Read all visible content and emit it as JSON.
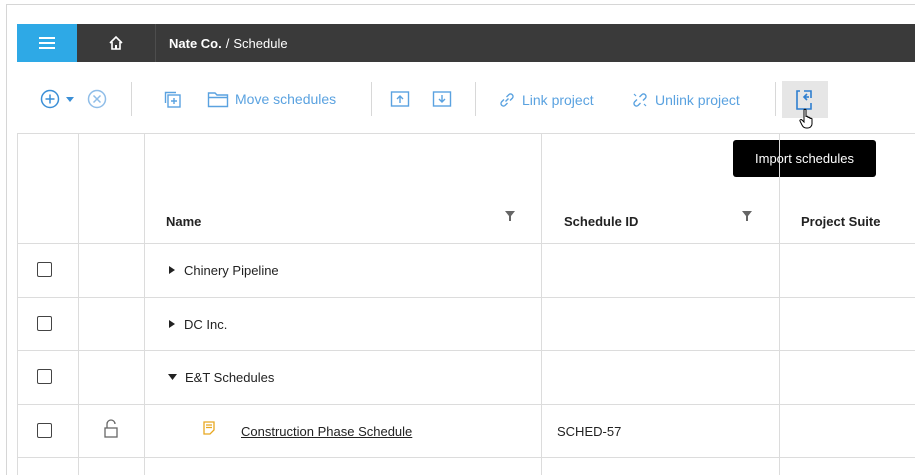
{
  "topbar": {
    "company": "Nate Co.",
    "separator": "/",
    "page": "Schedule"
  },
  "toolbar": {
    "move_schedules": "Move schedules",
    "link_project": "Link project",
    "unlink_project": "Unlink project",
    "tooltip": "Import schedules"
  },
  "table": {
    "headers": {
      "name": "Name",
      "schedule_id": "Schedule ID",
      "project_suite": "Project Suite"
    },
    "rows": [
      {
        "name": "Chinery Pipeline",
        "schedule_id": ""
      },
      {
        "name": "DC Inc.",
        "schedule_id": ""
      },
      {
        "name": "E&T Schedules",
        "schedule_id": ""
      },
      {
        "name": "Construction Phase Schedule",
        "schedule_id": "SCHED-57"
      }
    ]
  },
  "colors": {
    "accent": "#2ea9e6",
    "topbar": "#3a3a3a",
    "toolbar_icon": "#5aa2e0",
    "schedule_icon": "#e8a820"
  }
}
